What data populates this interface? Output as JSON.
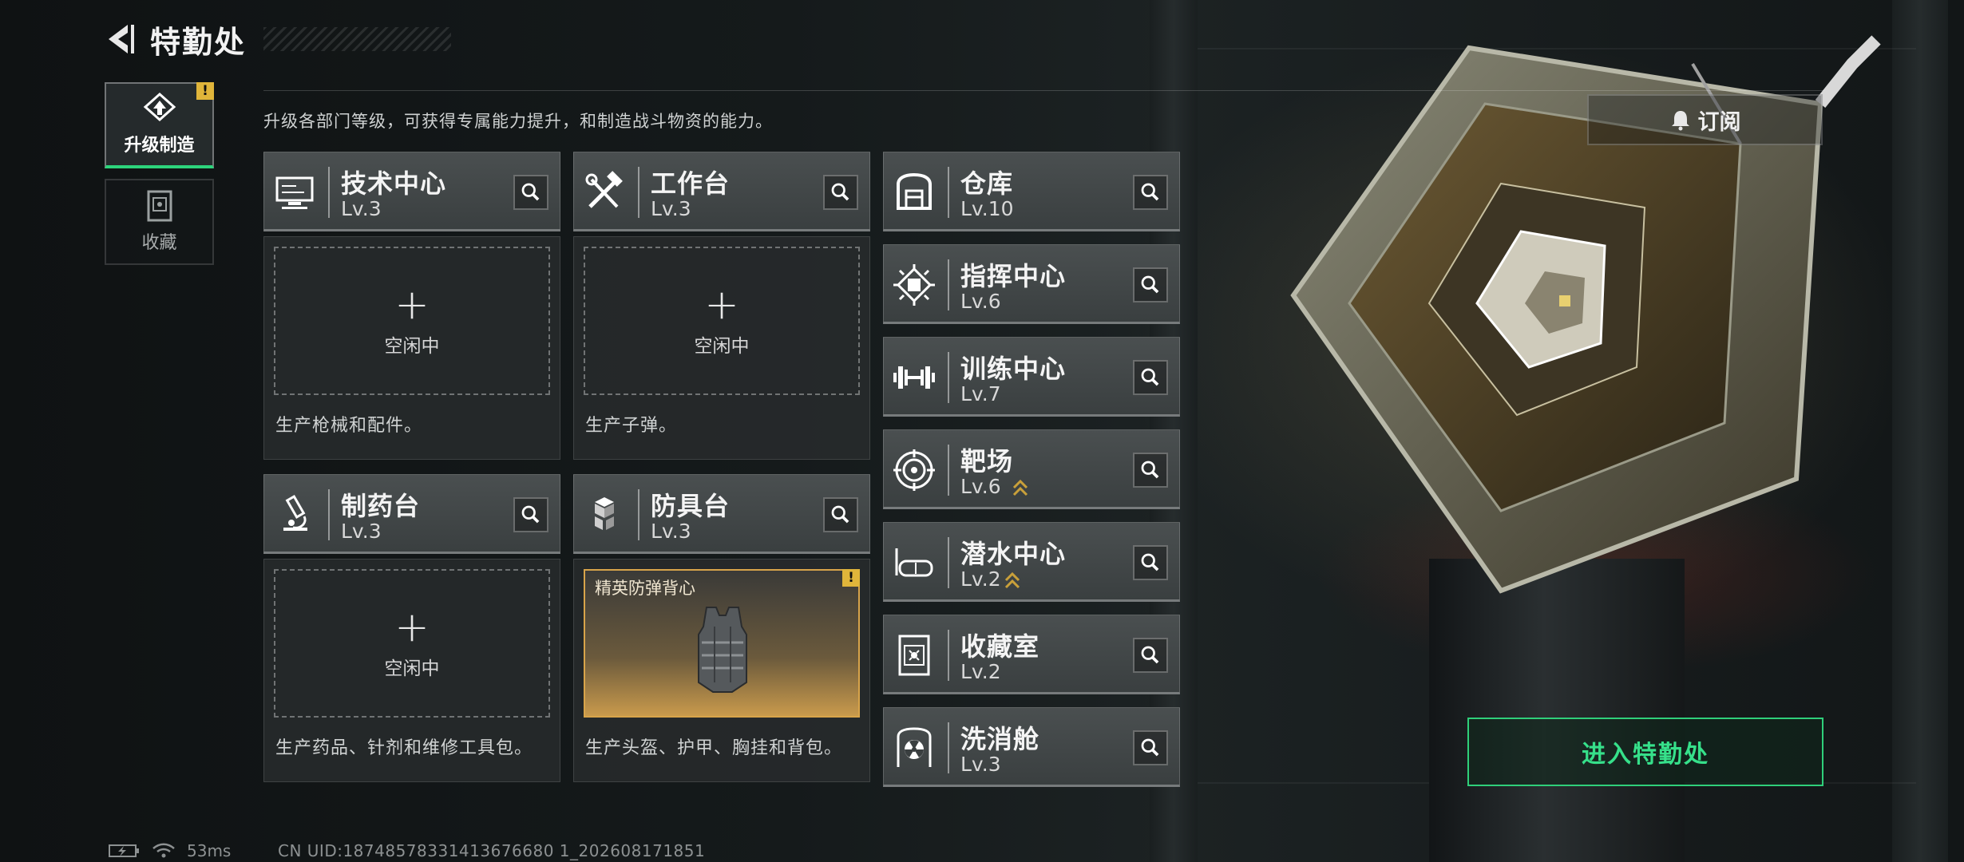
{
  "header": {
    "title": "特勤处"
  },
  "tabs": [
    {
      "label": "升级制造",
      "icon": "upgrade-craft-icon",
      "active": true,
      "alert": "!"
    },
    {
      "label": "收藏",
      "icon": "collection-icon",
      "active": false
    }
  ],
  "description": "升级各部门等级，可获得专属能力提升，和制造战斗物资的能力。",
  "subscribe": {
    "label": "订阅",
    "icon": "bell-icon"
  },
  "production_cards": [
    {
      "name": "技术中心",
      "level": "Lv.3",
      "icon": "computer-icon",
      "slot_plus": "+",
      "slot_status": "空闲中",
      "description": "生产枪械和配件。"
    },
    {
      "name": "工作台",
      "level": "Lv.3",
      "icon": "tools-icon",
      "slot_plus": "+",
      "slot_status": "空闲中",
      "description": "生产子弹。"
    },
    {
      "name": "制药台",
      "level": "Lv.3",
      "icon": "microscope-icon",
      "slot_plus": "+",
      "slot_status": "空闲中",
      "description": "生产药品、针剂和维修工具包。"
    },
    {
      "name": "防具台",
      "level": "Lv.3",
      "icon": "armor-boxes-icon",
      "crafting_item": "精英防弹背心",
      "alert": "!",
      "description": "生产头盔、护甲、胸挂和背包。"
    }
  ],
  "facilities": [
    {
      "name": "仓库",
      "level": "Lv.10",
      "icon": "warehouse-icon",
      "upgradable": false
    },
    {
      "name": "指挥中心",
      "level": "Lv.6",
      "icon": "chip-icon",
      "upgradable": false
    },
    {
      "name": "训练中心",
      "level": "Lv.7",
      "icon": "dumbbell-icon",
      "upgradable": false
    },
    {
      "name": "靶场",
      "level": "Lv.6",
      "icon": "target-icon",
      "upgradable": true
    },
    {
      "name": "潜水中心",
      "level": "Lv.2",
      "icon": "diving-mask-icon",
      "upgradable": true
    },
    {
      "name": "收藏室",
      "level": "Lv.2",
      "icon": "vault-icon",
      "upgradable": false
    },
    {
      "name": "洗消舱",
      "level": "Lv.3",
      "icon": "radiation-icon",
      "upgradable": false
    }
  ],
  "enter_button": {
    "label": "进入特勤处"
  },
  "status_bar": {
    "ping": "53ms",
    "uid": "CN UID:18748578331413676680 1_202608171851"
  },
  "colors": {
    "accent_green": "#36e08a",
    "alert_yellow": "#e0b53a",
    "craft_gold": "#d8a44a"
  }
}
